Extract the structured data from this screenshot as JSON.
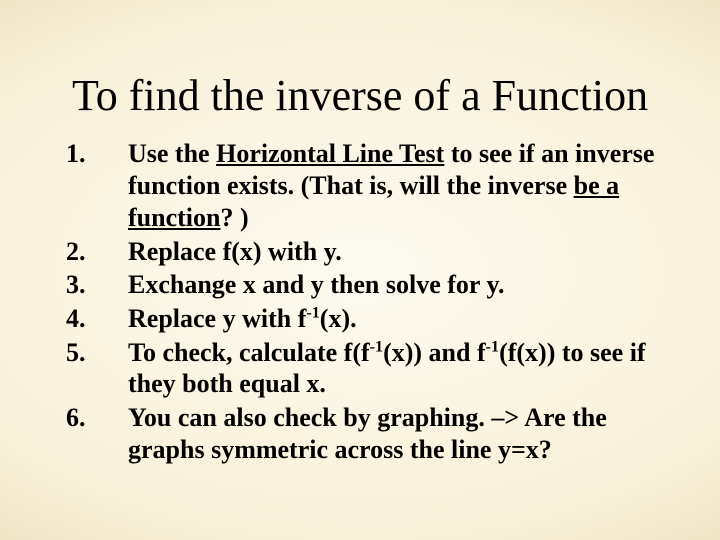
{
  "title": "To find the inverse of a Function",
  "items": [
    {
      "pre": "Use the ",
      "u1": "Horizontal Line Test",
      "mid": " to see if an inverse function exists. (That is, will the inverse ",
      "u2": "be a function",
      "post": "? )"
    },
    {
      "text": "Replace f(x) with y."
    },
    {
      "text": "Exchange x and y then solve for y."
    },
    {
      "pre": "Replace y with f",
      "sup": "-1",
      "post": "(x)."
    },
    {
      "pre": "To check, calculate f(f",
      "sup1": "-1",
      "mid": "(x)) and f",
      "sup2": "-1",
      "post": "(f(x)) to see if they both equal x."
    },
    {
      "text": "You can also check by graphing. –> Are the graphs symmetric across the line y=x?"
    }
  ]
}
